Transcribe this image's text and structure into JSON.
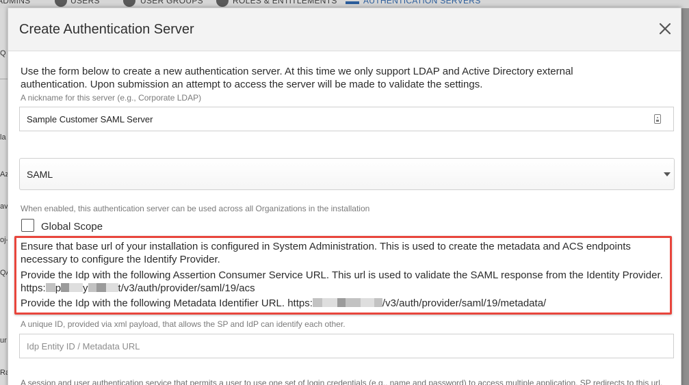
{
  "background": {
    "nav_items": [
      {
        "label": "ADMINS",
        "active": false
      },
      {
        "label": "USERS",
        "active": false
      },
      {
        "label": "USER GROUPS",
        "active": false
      },
      {
        "label": "ROLES & ENTITLEMENTS",
        "active": false
      },
      {
        "label": "AUTHENTICATION SERVERS",
        "active": true
      }
    ],
    "left_fragments": [
      "Q",
      "la",
      "Az",
      "av",
      "oj-",
      "QA",
      "ur",
      "Ra"
    ],
    "accent_color": "#2a5c9a"
  },
  "modal": {
    "title": "Create Authentication Server",
    "close_icon": "close-icon",
    "intro": "Use the form below to create a new authentication server. At this time we only support LDAP and Active Directory external authentication. Upon submission an attempt to access the server will be made to validate the settings.",
    "nickname": {
      "help": "A nickname for this server (e.g., Corporate LDAP)",
      "value": "Sample Customer SAML Server",
      "icon": "contact-card-icon"
    },
    "server_type": {
      "selected": "SAML",
      "icon": "caret-down-icon"
    },
    "global_scope": {
      "help": "When enabled, this authentication server can be used across all Organizations in the installation",
      "label": "Global Scope",
      "checked": false
    },
    "callout": {
      "border_color": "#e8453c",
      "line1": "Ensure that base url of your installation is configured in System Administration. This is used to create the metadata and ACS endpoints necessary to configure the Identify Provider.",
      "acs_prefix": "Provide the Idp with the following Assertion Consumer Service URL. This url is used to validate the SAML response from the Identity Provider. https:",
      "acs_mid1": "p",
      "acs_mid2": "y",
      "acs_suffix": "t/v3/auth/provider/saml/19/acs",
      "meta_prefix": "Provide the Idp with the following Metadata Identifier URL. https:",
      "meta_suffix": "/v3/auth/provider/saml/19/metadata/"
    },
    "entity_id": {
      "help": "A unique ID, provided via xml payload, that allows the SP and IdP can identify each other.",
      "placeholder": "Idp Entity ID / Metadata URL"
    },
    "sso_help": "A session and user authentication service that permits a user to use one set of login credentials (e.g., name and password) to access multiple application. SP redirects to this url."
  }
}
